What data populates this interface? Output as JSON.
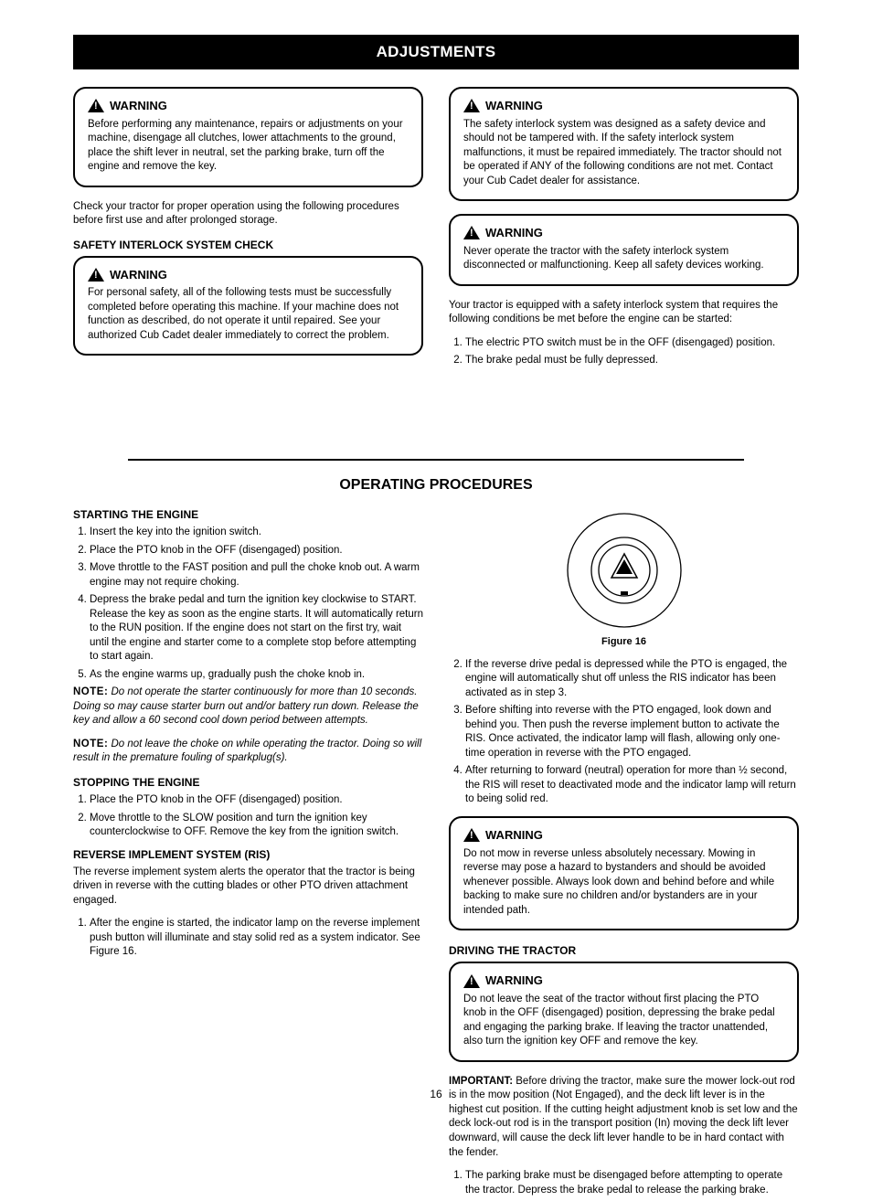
{
  "header": {
    "title": "ADJUSTMENTS"
  },
  "left_top": {
    "warning1": {
      "label": "WARNING",
      "text": "Before performing any maintenance, repairs or adjustments on your machine, disengage all clutches, lower attachments to the ground, place the shift lever in neutral, set the parking brake, turn off the engine and remove the key."
    },
    "intro": "Check your tractor for proper operation using the following procedures before first use and after prolonged storage.",
    "heading": "SAFETY INTERLOCK SYSTEM CHECK",
    "warning2": {
      "label": "WARNING",
      "text": "For personal safety, all of the following tests must be successfully completed before operating this machine. If your machine does not function as described, do not operate it until repaired. See your authorized Cub Cadet dealer immediately to correct the problem."
    }
  },
  "right_top": {
    "warning1": {
      "label": "WARNING",
      "text": "The safety interlock system was designed as a safety device and should not be tampered with. If the safety interlock system malfunctions, it must be repaired immediately. The tractor should not be operated if ANY of the following conditions are not met. Contact your Cub Cadet dealer for assistance."
    },
    "warning2": {
      "label": "WARNING",
      "text": "Never operate the tractor with the safety interlock system disconnected or malfunctioning. Keep all safety devices working."
    },
    "steps_intro": "Your tractor is equipped with a safety interlock system that requires the following conditions be met before the engine can be started:",
    "steps": [
      "The electric PTO switch must be in the OFF (disengaged) position.",
      "The brake pedal must be fully depressed."
    ]
  },
  "divider_title": "OPERATING PROCEDURES",
  "left_bottom": {
    "starting_head": "STARTING THE ENGINE",
    "starting_steps": [
      "Insert the key into the ignition switch.",
      "Place the PTO knob in the OFF (disengaged) position.",
      "Move throttle to the FAST position and pull the choke knob out. A warm engine may not require choking.",
      "Depress the brake pedal and turn the ignition key clockwise to START. Release the key as soon as the engine starts. It will automatically return to the RUN position. If the engine does not start on the first try, wait until the engine and starter come to a complete stop before attempting to start again.",
      "As the engine warms up, gradually push the choke knob in."
    ],
    "note1": {
      "label": "NOTE:",
      "text": "Do not operate the starter continuously for more than 10 seconds. Doing so may cause starter burn out and/or battery run down. Release the key and allow a 60 second cool down period between attempts."
    },
    "note2": {
      "label": "NOTE:",
      "text": "Do not leave the choke on while operating the tractor. Doing so will result in the premature fouling of sparkplug(s)."
    },
    "stopping_head": "STOPPING THE ENGINE",
    "stopping_steps": [
      "Place the PTO knob in the OFF (disengaged) position.",
      "Move throttle to the SLOW position and turn the ignition key counterclockwise to OFF. Remove the key from the ignition switch."
    ],
    "ris_head": "REVERSE IMPLEMENT SYSTEM (RIS)",
    "ris_para": "The reverse implement system alerts the operator that the tractor is being driven in reverse with the cutting blades or other PTO driven attachment engaged.",
    "ris_steps": [
      "After the engine is started, the indicator lamp on the reverse implement push button will illuminate and stay solid red as a system indicator. See Figure 16."
    ]
  },
  "right_bottom": {
    "fig_caption": "Figure 16",
    "steps": [
      "If the reverse drive pedal is depressed while the PTO is engaged, the engine will automatically shut off unless the RIS indicator has been activated as in step 3.",
      "Before shifting into reverse with the PTO engaged, look down and behind you. Then push the reverse implement button to activate the RIS. Once activated, the indicator lamp will flash, allowing only one-time operation in reverse with the PTO engaged.",
      "After returning to forward (neutral) operation for more than ½ second, the RIS will reset to deactivated mode and the indicator lamp will return to being solid red."
    ],
    "warning": {
      "label": "WARNING",
      "text": "Do not mow in reverse unless absolutely necessary. Mowing in reverse may pose a hazard to bystanders and should be avoided whenever possible. Always look down and behind before and while backing to make sure no children and/or bystanders are in your intended path."
    },
    "driving_head": "DRIVING THE TRACTOR",
    "warning2": {
      "label": "WARNING",
      "text": "Do not leave the seat of the tractor without first placing the PTO knob in the OFF (disengaged) position, depressing the brake pedal and engaging the parking brake. If leaving the tractor unattended, also turn the ignition key OFF and remove the key."
    },
    "important": {
      "label": "IMPORTANT:",
      "text": "Before driving the tractor, make sure the mower lock-out rod is in the mow position (Not Engaged), and the deck lift lever is in the highest cut position. If the cutting height adjustment knob is set low and the deck lock-out rod is in the transport position (In) moving the deck lift lever downward, will cause the deck lift lever handle to be in hard contact with the fender."
    },
    "driving_steps": [
      "The parking brake must be disengaged before attempting to operate the tractor. Depress the brake pedal to release the parking brake."
    ]
  },
  "page_number": "16"
}
